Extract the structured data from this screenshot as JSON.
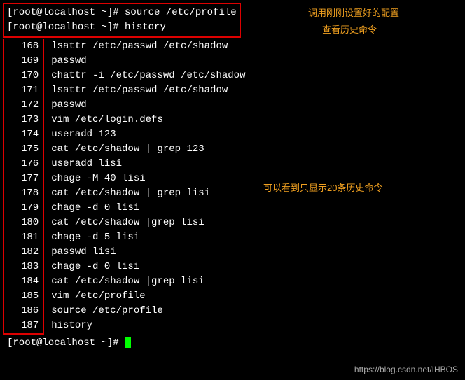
{
  "prompts": {
    "line1_prefix": "[root@localhost ~]# ",
    "line1_cmd": "source /etc/profile",
    "line2_prefix": "[root@localhost ~]# ",
    "line2_cmd": "history",
    "bottom_prefix": "[root@localhost ~]# "
  },
  "annotations": {
    "a1": "调用刚刚设置好的配置",
    "a2": "查看历史命令",
    "a3": "可以看到只显示20条历史命令"
  },
  "history": [
    {
      "num": "168",
      "cmd": "lsattr /etc/passwd /etc/shadow"
    },
    {
      "num": "169",
      "cmd": "passwd"
    },
    {
      "num": "170",
      "cmd": "chattr -i /etc/passwd /etc/shadow"
    },
    {
      "num": "171",
      "cmd": "lsattr /etc/passwd /etc/shadow"
    },
    {
      "num": "172",
      "cmd": "passwd"
    },
    {
      "num": "173",
      "cmd": "vim /etc/login.defs"
    },
    {
      "num": "174",
      "cmd": "useradd 123"
    },
    {
      "num": "175",
      "cmd": "cat /etc/shadow | grep 123"
    },
    {
      "num": "176",
      "cmd": "useradd lisi"
    },
    {
      "num": "177",
      "cmd": "chage -M 40 lisi"
    },
    {
      "num": "178",
      "cmd": "cat /etc/shadow | grep lisi"
    },
    {
      "num": "179",
      "cmd": "chage -d 0 lisi"
    },
    {
      "num": "180",
      "cmd": "cat /etc/shadow |grep lisi"
    },
    {
      "num": "181",
      "cmd": "chage -d 5 lisi"
    },
    {
      "num": "182",
      "cmd": "passwd lisi"
    },
    {
      "num": "183",
      "cmd": "chage -d 0 lisi"
    },
    {
      "num": "184",
      "cmd": "cat /etc/shadow |grep lisi"
    },
    {
      "num": "185",
      "cmd": "vim /etc/profile"
    },
    {
      "num": "186",
      "cmd": "source /etc/profile"
    },
    {
      "num": "187",
      "cmd": "history"
    }
  ],
  "watermark": "https://blog.csdn.net/IHBOS"
}
